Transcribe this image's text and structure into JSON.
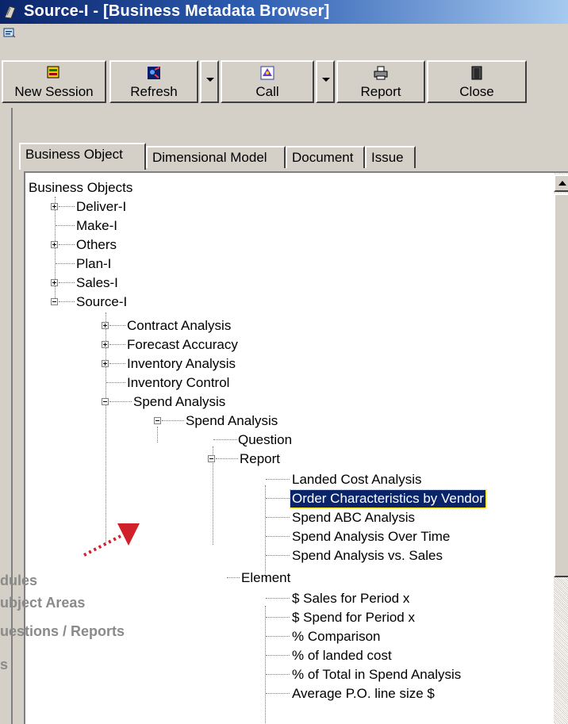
{
  "window": {
    "title": "Source-I - [Business Metadata Browser]"
  },
  "toolbar": {
    "buttons": [
      {
        "label": "New Session"
      },
      {
        "label": "Refresh"
      },
      {
        "label": "Call"
      },
      {
        "label": "Report"
      },
      {
        "label": "Close"
      }
    ]
  },
  "tabs": [
    {
      "label": "Business Object",
      "active": true
    },
    {
      "label": "Dimensional Model"
    },
    {
      "label": "Document"
    },
    {
      "label": "Issue"
    }
  ],
  "tree": {
    "nodes": [
      {
        "label": "Business Objects"
      },
      {
        "label": "Deliver-I",
        "expander": "+"
      },
      {
        "label": "Make-I"
      },
      {
        "label": "Others",
        "expander": "+"
      },
      {
        "label": "Plan-I"
      },
      {
        "label": "Sales-I",
        "expander": "+"
      },
      {
        "label": "Source-I",
        "expander": "-"
      },
      {
        "label": "Contract Analysis",
        "expander": "+"
      },
      {
        "label": "Forecast Accuracy",
        "expander": "+"
      },
      {
        "label": "Inventory Analysis",
        "expander": "+"
      },
      {
        "label": "Inventory Control"
      },
      {
        "label": "Spend Analysis",
        "expander": "-"
      },
      {
        "label": "Spend Analysis",
        "expander": "-"
      },
      {
        "label": "Question"
      },
      {
        "label": "Report",
        "expander": "-"
      },
      {
        "label": "Landed Cost Analysis"
      },
      {
        "label": "Order Characteristics by Vendor",
        "selected": true
      },
      {
        "label": "Spend ABC Analysis"
      },
      {
        "label": "Spend Analysis Over Time"
      },
      {
        "label": "Spend Analysis vs. Sales"
      },
      {
        "label": "Element"
      },
      {
        "label": "$ Sales for Period x"
      },
      {
        "label": "$ Spend for Period x"
      },
      {
        "label": "% Comparison"
      },
      {
        "label": "% of landed cost"
      },
      {
        "label": "% of Total in Spend Analysis"
      },
      {
        "label": "Average P.O. line size $"
      }
    ]
  },
  "annotation": {
    "lines": [
      "dules",
      "ubject Areas",
      "uestions / Reports",
      "s"
    ],
    "arrow_color": "#d0202a"
  }
}
